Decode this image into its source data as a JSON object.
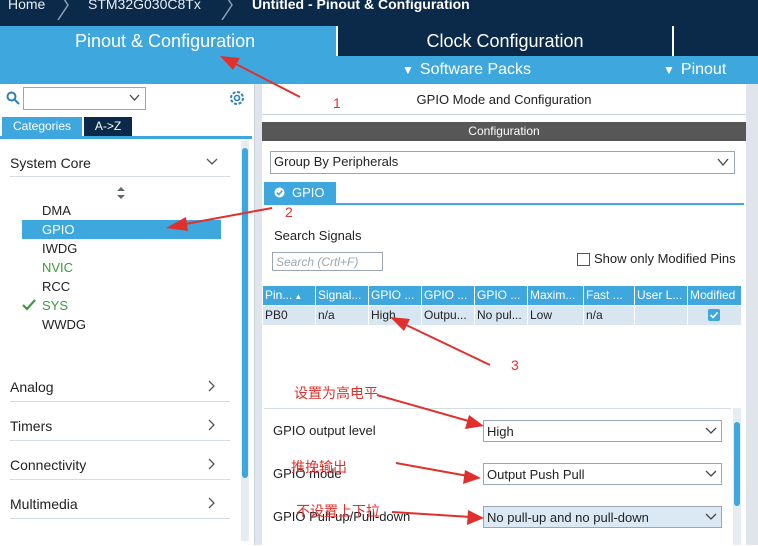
{
  "breadcrumb": {
    "items": [
      "Home",
      "STM32G030C8Tx",
      "Untitled - Pinout & Configuration"
    ]
  },
  "tabs": {
    "pinout": "Pinout & Configuration",
    "clock": "Clock Configuration"
  },
  "menu": {
    "software_packs": "Software Packs",
    "pinout": "Pinout"
  },
  "left": {
    "category_tabs": [
      "Categories",
      "A->Z"
    ],
    "system_core": "System Core",
    "items": [
      {
        "label": "DMA",
        "state": "normal"
      },
      {
        "label": "GPIO",
        "state": "selected"
      },
      {
        "label": "IWDG",
        "state": "normal"
      },
      {
        "label": "NVIC",
        "state": "green"
      },
      {
        "label": "RCC",
        "state": "normal"
      },
      {
        "label": "SYS",
        "state": "green-checked"
      },
      {
        "label": "WWDG",
        "state": "normal"
      }
    ],
    "sections": [
      "Analog",
      "Timers",
      "Connectivity",
      "Multimedia"
    ]
  },
  "right": {
    "title": "GPIO Mode and Configuration",
    "configuration_header": "Configuration",
    "group_by": "Group By Peripherals",
    "gpio_tab": "GPIO",
    "search_label": "Search Signals",
    "search_placeholder": "Search (Crtl+F)",
    "show_modified": "Show only Modified Pins",
    "table": {
      "headers": [
        "Pin...",
        "Signal...",
        "GPIO ...",
        "GPIO ...",
        "GPIO ...",
        "Maxim...",
        "Fast ...",
        "User L...",
        "Modified"
      ],
      "row": [
        "PB0",
        "n/a",
        "High",
        "Outpu...",
        "No pul...",
        "Low",
        "n/a",
        "",
        "checked"
      ]
    },
    "properties": [
      {
        "label": "GPIO output level",
        "value": "High"
      },
      {
        "label": "GPIO mode",
        "value": "Output Push Pull"
      },
      {
        "label": "GPIO Pull-up/Pull-down",
        "value": "No pull-up and no pull-down"
      }
    ]
  },
  "annotations": {
    "n1": "1",
    "n2": "2",
    "n3": "3",
    "high_note": "设置为高电平",
    "pushpull_note": "推挽输出",
    "pull_note": "不设置上下拉"
  },
  "colors": {
    "accent": "#3ea8de",
    "navy": "#0b2a4a",
    "annotation_red": "#e0302d",
    "green": "#3c9a3c"
  }
}
